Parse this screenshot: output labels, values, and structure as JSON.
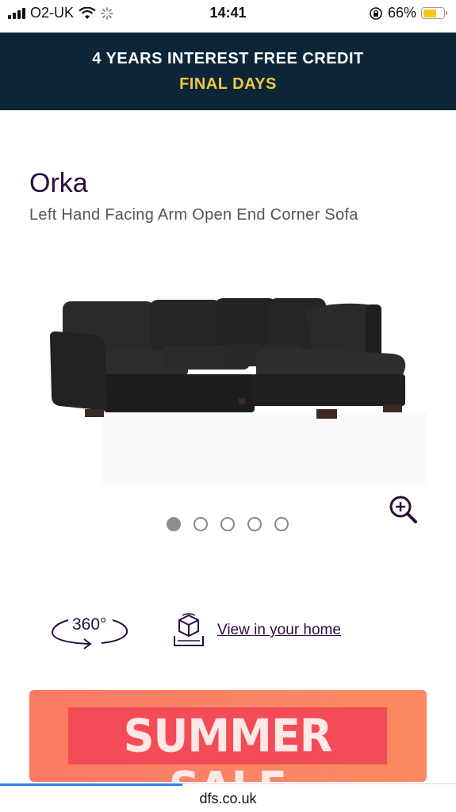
{
  "status_bar": {
    "carrier": "O2-UK",
    "time": "14:41",
    "battery_percent": "66%",
    "battery_level": 0.66,
    "battery_color": "#f6c614",
    "icons": [
      "signal-icon",
      "wifi-icon",
      "loading-spinner-icon",
      "rotation-lock-icon",
      "battery-icon"
    ]
  },
  "promo": {
    "line1": "4 YEARS INTEREST FREE CREDIT",
    "line2": "FINAL DAYS",
    "background": "#0c2638",
    "highlight_color": "#f2c843"
  },
  "product": {
    "name": "Orka",
    "description": "Left Hand Facing Arm Open End Corner Sofa",
    "image_alt_icon": "corner-sofa-image"
  },
  "gallery": {
    "dot_count": 5,
    "active_index": 0,
    "zoom_icon": "zoom-in-icon"
  },
  "actions": {
    "view_360_label": "360°",
    "view_in_home_label": "View in your home",
    "ar_icon": "ar-cube-icon"
  },
  "sale_banner": {
    "text": "SUMMER SALE"
  },
  "browser": {
    "url": "dfs.co.uk",
    "load_progress": 0.4
  },
  "colors": {
    "brand_purple": "#2b0d3d",
    "sale_red": "#f34c57",
    "sale_orange": "#fb7a62"
  }
}
